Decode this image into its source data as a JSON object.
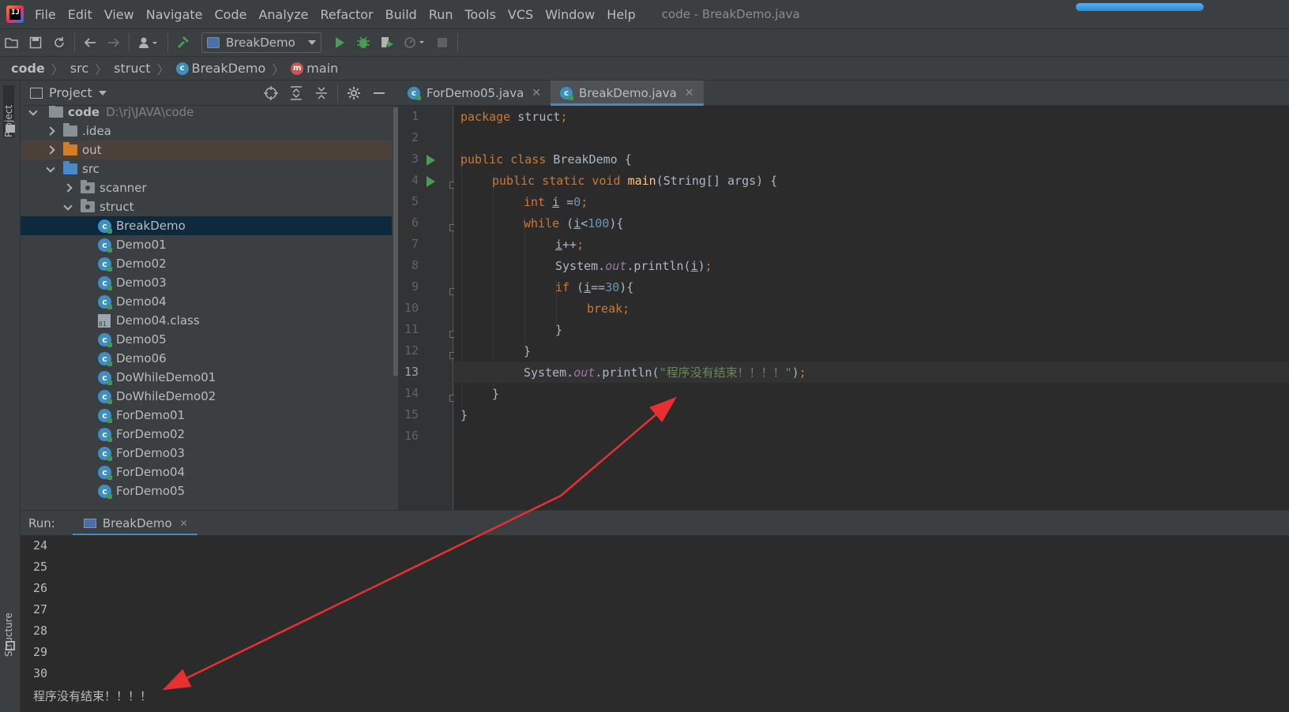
{
  "menubar": {
    "items": [
      "File",
      "Edit",
      "View",
      "Navigate",
      "Code",
      "Analyze",
      "Refactor",
      "Build",
      "Run",
      "Tools",
      "VCS",
      "Window",
      "Help"
    ],
    "window_title": "code - BreakDemo.java"
  },
  "toolbar": {
    "run_config": "BreakDemo",
    "icons": [
      "open-folder-icon",
      "save-icon",
      "sync-icon",
      "back-icon",
      "forward-icon",
      "user-icon",
      "build-hammer-icon",
      "run-icon",
      "debug-icon",
      "coverage-icon",
      "profile-icon",
      "stop-icon"
    ]
  },
  "breadcrumb": {
    "items": [
      "code",
      "src",
      "struct",
      "BreakDemo",
      "main"
    ]
  },
  "left_strip": {
    "project_tab": "Project",
    "structure_tab": "Structure"
  },
  "project_panel": {
    "title": "Project",
    "root": {
      "name": "code",
      "path": "D:\\rj\\JAVA\\code"
    },
    "items": [
      {
        "label": ".idea",
        "type": "folder"
      },
      {
        "label": "out",
        "type": "folder-excluded"
      },
      {
        "label": "src",
        "type": "folder-source"
      },
      {
        "label": "scanner",
        "type": "package"
      },
      {
        "label": "struct",
        "type": "package"
      },
      {
        "label": "BreakDemo",
        "type": "class",
        "selected": true
      },
      {
        "label": "Demo01",
        "type": "class"
      },
      {
        "label": "Demo02",
        "type": "class"
      },
      {
        "label": "Demo03",
        "type": "class"
      },
      {
        "label": "Demo04",
        "type": "class"
      },
      {
        "label": "Demo04.class",
        "type": "binary"
      },
      {
        "label": "Demo05",
        "type": "class"
      },
      {
        "label": "Demo06",
        "type": "class"
      },
      {
        "label": "DoWhileDemo01",
        "type": "class"
      },
      {
        "label": "DoWhileDemo02",
        "type": "class"
      },
      {
        "label": "ForDemo01",
        "type": "class"
      },
      {
        "label": "ForDemo02",
        "type": "class"
      },
      {
        "label": "ForDemo03",
        "type": "class"
      },
      {
        "label": "ForDemo04",
        "type": "class"
      },
      {
        "label": "ForDemo05",
        "type": "class"
      }
    ]
  },
  "editor": {
    "tabs": [
      {
        "label": "ForDemo05.java",
        "active": false
      },
      {
        "label": "BreakDemo.java",
        "active": true
      }
    ],
    "line_numbers": [
      "1",
      "2",
      "3",
      "4",
      "5",
      "6",
      "7",
      "8",
      "9",
      "10",
      "11",
      "12",
      "13",
      "14",
      "15",
      "16"
    ],
    "current_line": 13,
    "code": {
      "l1_kw": "package",
      "l1_rest": " struct",
      "l1_semi": ";",
      "l3_kw": "public class",
      "l3_rest": " BreakDemo {",
      "l4_kw": "public static void",
      "l4_fn": "main",
      "l4_rest": "(String[] args) {",
      "l5_kw": "int",
      "l5_var": "i",
      "l5_op": " =",
      "l5_num": "0",
      "l5_semi": ";",
      "l6_kw": "while",
      "l6_open": " (",
      "l6_var": "i",
      "l6_op": "<",
      "l6_num": "100",
      "l6_close": "){",
      "l7_var": "i",
      "l7_op": "++",
      "l7_semi": ";",
      "l8_sys": "System.",
      "l8_out": "out",
      "l8_call": ".println(",
      "l8_var": "i",
      "l8_close": ")",
      "l8_semi": ";",
      "l9_kw": "if",
      "l9_open": " (",
      "l9_var": "i",
      "l9_op": "==",
      "l9_num": "30",
      "l9_close": "){",
      "l10_kw": "break",
      "l10_semi": ";",
      "l11": "}",
      "l12": "}",
      "l13_sys": "System.",
      "l13_out": "out",
      "l13_call": ".println(",
      "l13_str": "\"程序没有结束！！！！\"",
      "l13_close": ")",
      "l13_semi": ";",
      "l14": "}",
      "l15": "}"
    }
  },
  "run_window": {
    "label": "Run:",
    "tab": "BreakDemo",
    "output": [
      "24",
      "25",
      "26",
      "27",
      "28",
      "29",
      "30",
      "程序没有结束！！！！"
    ]
  },
  "colors": {
    "accent": "#4a88c7",
    "keyword": "#cc7832",
    "number": "#6897bb",
    "string": "#6a8759",
    "annotation_arrow": "#e83030"
  }
}
